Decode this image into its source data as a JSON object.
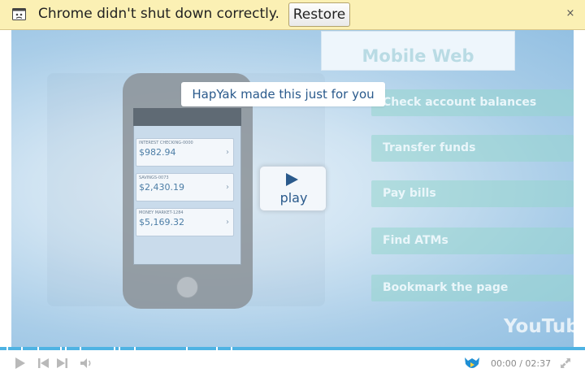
{
  "infobar": {
    "message": "Chrome didn't shut down correctly.",
    "restore_label": "Restore",
    "close_glyph": "×",
    "icon": "crashed-tab-icon"
  },
  "video": {
    "tooltip": "HapYak made this just for you",
    "play_label": "play",
    "watermark": "YouTube",
    "slide": {
      "title": "Mobile Web",
      "items": [
        "Check account balances",
        "Transfer funds",
        "Pay bills",
        "Find ATMs",
        "Bookmark the page"
      ],
      "accounts": [
        {
          "label": "INTEREST CHECKING-0000",
          "amount": "$982.94"
        },
        {
          "label": "SAVINGS-0073",
          "amount": "$2,430.19"
        },
        {
          "label": "MONEY MARKET-1284",
          "amount": "$5,169.32"
        }
      ]
    }
  },
  "controls": {
    "time_current": "00:00",
    "time_separator": "/",
    "time_total": "02:37",
    "progress_fraction": 0,
    "icons": [
      "play-icon",
      "previous-icon",
      "next-icon",
      "volume-icon",
      "hapyak-logo-icon",
      "fullscreen-icon"
    ]
  },
  "colors": {
    "infobar_bg": "#fbf0b4",
    "progress": "#4eb3e3",
    "accent_blue": "#2a5a8c"
  }
}
